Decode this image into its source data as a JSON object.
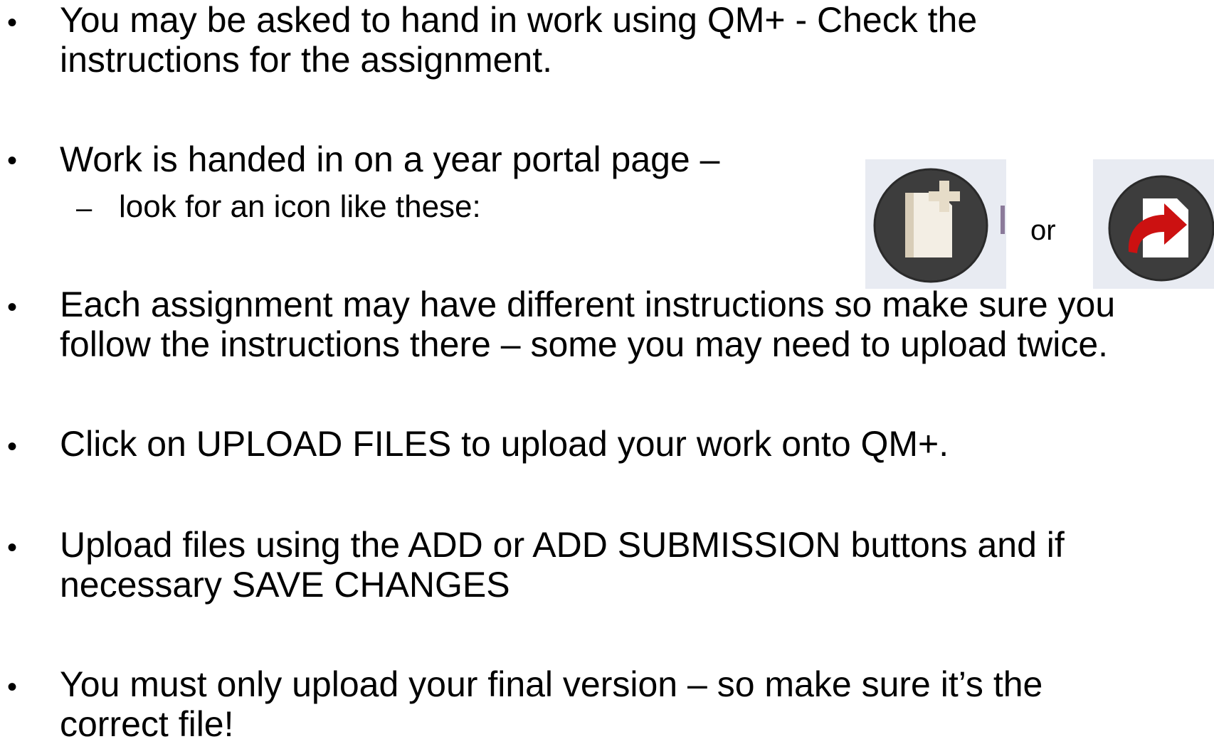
{
  "slide": {
    "bullets": [
      {
        "lines": [
          "You may be asked to hand in work using QM+ - Check the",
          "instructions for the assignment."
        ]
      },
      {
        "lines": [
          "Work is handed in on a year portal page –"
        ]
      },
      {
        "lines": [
          "Each assignment may have different instructions so make sure you",
          "follow the instructions there – some you may need to upload twice."
        ]
      },
      {
        "lines": [
          "Click on UPLOAD FILES to upload your work onto QM+."
        ]
      },
      {
        "lines": [
          "Upload files using the ADD or ADD SUBMISSION buttons and if",
          "necessary SAVE CHANGES"
        ]
      },
      {
        "lines": [
          "You must only upload your final version – so make sure it’s the",
          "correct file!"
        ]
      }
    ],
    "sub_bullet": "look for an icon like these:",
    "bullet_char": "•",
    "dash_char": "–",
    "or_label": "or",
    "icons": {
      "first": "add-file-icon",
      "second": "submit-file-icon",
      "icon_bg": "#e8ebf2",
      "circle_color": "#3d3d3d",
      "accent_red": "#cc1111"
    }
  }
}
